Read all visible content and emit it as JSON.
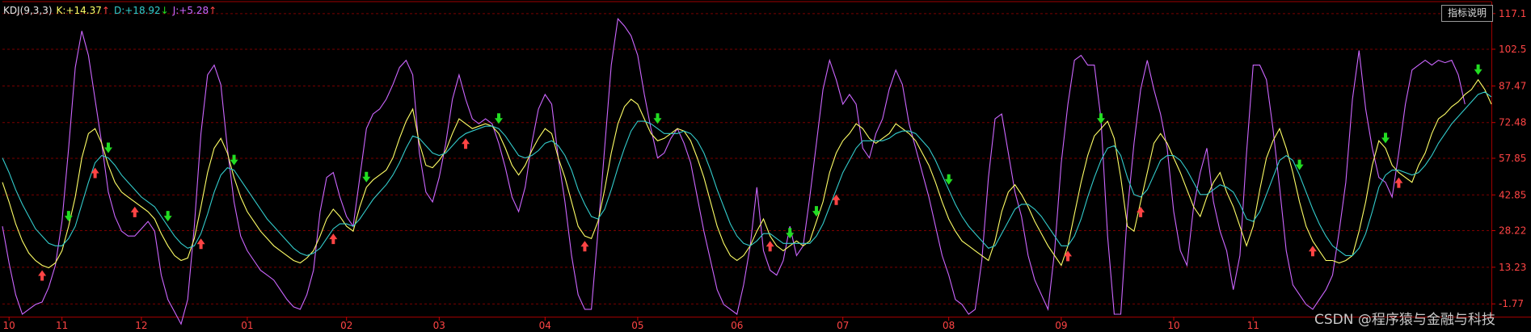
{
  "indicator": {
    "name": "KDJ(9,3,3)",
    "k_label": "K:",
    "k_value": "+14.37",
    "k_arrow": "↑",
    "d_label": "D:",
    "d_value": "+18.92",
    "d_arrow": "↓",
    "j_label": "J:",
    "j_value": "+5.28",
    "j_arrow": "↑"
  },
  "help_button_label": "指标说明",
  "watermark": "CSDN @程序猿与金融与科技",
  "colors": {
    "background": "#000000",
    "k_line": "#ffff66",
    "d_line": "#33cccc",
    "j_line": "#cc66ff",
    "grid": "#7a0000",
    "axis_label": "#ff4444",
    "buy_arrow": "#ff4444",
    "sell_arrow": "#22dd22",
    "legend_name": "#e8e8e8"
  },
  "chart_data": {
    "type": "line",
    "title": "KDJ(9,3,3)",
    "xlabel": "",
    "ylabel": "",
    "ylim": [
      -7,
      122
    ],
    "y_ticks": [
      "117.1",
      "102.5",
      "87.47",
      "72.48",
      "57.85",
      "42.85",
      "28.22",
      "13.23",
      "-1.77"
    ],
    "y_tick_values": [
      117.1,
      102.5,
      87.47,
      72.48,
      57.85,
      42.85,
      28.22,
      13.23,
      -1.77
    ],
    "x_tick_labels": [
      "10",
      "11",
      "12",
      "01",
      "02",
      "03",
      "04",
      "05",
      "06",
      "07",
      "08",
      "09",
      "10",
      "11"
    ],
    "x_tick_index": [
      1,
      9,
      21,
      37,
      52,
      66,
      82,
      96,
      111,
      127,
      143,
      160,
      177,
      189
    ],
    "grid": true,
    "legend": "top-left",
    "series": [
      {
        "name": "K",
        "values": [
          48,
          40,
          31,
          24,
          19,
          16,
          14,
          13,
          15,
          20,
          30,
          42,
          58,
          68,
          70,
          64,
          55,
          48,
          44,
          42,
          40,
          38,
          36,
          33,
          27,
          22,
          18,
          16,
          17,
          25,
          38,
          52,
          62,
          66,
          60,
          50,
          42,
          36,
          32,
          28,
          25,
          22,
          20,
          18,
          16,
          15,
          17,
          20,
          26,
          33,
          37,
          34,
          30,
          28,
          38,
          46,
          49,
          51,
          53,
          58,
          66,
          73,
          78,
          64,
          55,
          54,
          57,
          61,
          68,
          74,
          72,
          70,
          71,
          72,
          71,
          68,
          62,
          55,
          51,
          55,
          61,
          66,
          70,
          68,
          58,
          50,
          40,
          30,
          26,
          25,
          32,
          45,
          60,
          72,
          79,
          82,
          80,
          74,
          68,
          65,
          66,
          68,
          70,
          69,
          65,
          58,
          50,
          40,
          30,
          23,
          18,
          16,
          18,
          22,
          28,
          33,
          26,
          22,
          20,
          22,
          24,
          22,
          24,
          32,
          40,
          52,
          60,
          65,
          68,
          72,
          70,
          66,
          64,
          66,
          68,
          72,
          70,
          68,
          65,
          60,
          55,
          48,
          40,
          33,
          28,
          24,
          22,
          20,
          18,
          16,
          24,
          36,
          44,
          47,
          43,
          38,
          32,
          27,
          22,
          18,
          14,
          22,
          35,
          48,
          59,
          67,
          70,
          73,
          66,
          50,
          30,
          28,
          40,
          52,
          64,
          68,
          64,
          58,
          52,
          45,
          38,
          34,
          42,
          48,
          52,
          44,
          38,
          30,
          22,
          30,
          45,
          58,
          65,
          70,
          62,
          52,
          40,
          30,
          24,
          20,
          16,
          16,
          15,
          16,
          18,
          28,
          40,
          55,
          65,
          62,
          55,
          52,
          50,
          48,
          55,
          60,
          68,
          74,
          76,
          79,
          81,
          84,
          86,
          90,
          86,
          80
        ]
      },
      {
        "name": "D",
        "values": [
          58,
          52,
          45,
          39,
          34,
          29,
          26,
          23,
          22,
          22,
          25,
          30,
          39,
          48,
          56,
          59,
          58,
          55,
          51,
          48,
          45,
          42,
          40,
          38,
          34,
          30,
          26,
          23,
          21,
          22,
          27,
          35,
          44,
          51,
          54,
          53,
          49,
          45,
          41,
          37,
          33,
          30,
          27,
          24,
          21,
          19,
          18,
          19,
          21,
          25,
          29,
          31,
          31,
          30,
          33,
          37,
          41,
          44,
          47,
          51,
          56,
          62,
          67,
          66,
          63,
          60,
          59,
          60,
          63,
          66,
          68,
          69,
          70,
          71,
          71,
          70,
          67,
          63,
          59,
          58,
          59,
          61,
          64,
          65,
          63,
          59,
          53,
          45,
          39,
          34,
          33,
          37,
          45,
          54,
          62,
          69,
          73,
          73,
          72,
          70,
          68,
          68,
          68,
          69,
          68,
          65,
          60,
          53,
          45,
          38,
          31,
          26,
          23,
          22,
          24,
          27,
          27,
          25,
          23,
          23,
          23,
          23,
          23,
          26,
          31,
          38,
          45,
          52,
          57,
          62,
          65,
          65,
          65,
          65,
          66,
          68,
          69,
          69,
          68,
          65,
          62,
          57,
          51,
          45,
          39,
          34,
          30,
          27,
          24,
          21,
          22,
          27,
          32,
          37,
          39,
          39,
          37,
          34,
          30,
          26,
          22,
          22,
          26,
          33,
          42,
          50,
          57,
          62,
          63,
          59,
          50,
          43,
          42,
          45,
          51,
          57,
          59,
          59,
          57,
          53,
          48,
          43,
          43,
          45,
          47,
          46,
          44,
          39,
          33,
          32,
          36,
          43,
          50,
          57,
          59,
          57,
          51,
          44,
          37,
          31,
          26,
          22,
          20,
          18,
          18,
          21,
          27,
          36,
          46,
          51,
          53,
          53,
          52,
          51,
          52,
          55,
          59,
          64,
          68,
          72,
          75,
          78,
          81,
          84,
          85,
          83
        ]
      },
      {
        "name": "J",
        "values": [
          30,
          15,
          2,
          -6,
          -4,
          -2,
          -1,
          5,
          14,
          32,
          62,
          95,
          110,
          100,
          82,
          64,
          44,
          34,
          28,
          26,
          26,
          29,
          32,
          28,
          10,
          0,
          -5,
          -10,
          0,
          30,
          68,
          92,
          96,
          88,
          62,
          40,
          26,
          20,
          16,
          12,
          10,
          8,
          4,
          0,
          -3,
          -4,
          2,
          12,
          36,
          50,
          52,
          42,
          34,
          30,
          50,
          70,
          76,
          78,
          82,
          88,
          95,
          98,
          92,
          60,
          44,
          40,
          50,
          64,
          82,
          92,
          82,
          74,
          72,
          74,
          72,
          64,
          54,
          42,
          36,
          46,
          64,
          78,
          84,
          80,
          58,
          40,
          18,
          2,
          -4,
          -4,
          28,
          62,
          96,
          115,
          112,
          108,
          100,
          84,
          70,
          58,
          60,
          66,
          70,
          64,
          56,
          42,
          28,
          16,
          4,
          -2,
          -4,
          -6,
          6,
          22,
          46,
          20,
          12,
          10,
          16,
          30,
          18,
          22,
          42,
          64,
          86,
          98,
          90,
          80,
          84,
          80,
          62,
          58,
          68,
          74,
          86,
          94,
          88,
          72,
          62,
          52,
          42,
          30,
          18,
          10,
          0,
          -2,
          -6,
          -4,
          16,
          50,
          74,
          76,
          60,
          44,
          34,
          18,
          8,
          2,
          -4,
          20,
          56,
          80,
          98,
          100,
          96,
          96,
          74,
          26,
          -6,
          -6,
          36,
          64,
          86,
          98,
          86,
          76,
          62,
          36,
          20,
          14,
          38,
          52,
          62,
          40,
          28,
          20,
          4,
          18,
          60,
          96,
          96,
          90,
          70,
          46,
          20,
          6,
          2,
          -2,
          -4,
          0,
          4,
          10,
          28,
          48,
          82,
          102,
          78,
          62,
          50,
          48,
          42,
          60,
          80,
          94,
          96,
          98,
          96,
          98,
          97,
          98,
          92,
          80
        ]
      }
    ],
    "buy_signals": [
      6,
      14,
      20,
      30,
      50,
      70,
      88,
      116,
      126,
      161,
      172,
      198,
      211
    ],
    "sell_signals": [
      10,
      16,
      25,
      35,
      55,
      75,
      99,
      119,
      123,
      143,
      166,
      196,
      209,
      223
    ]
  }
}
